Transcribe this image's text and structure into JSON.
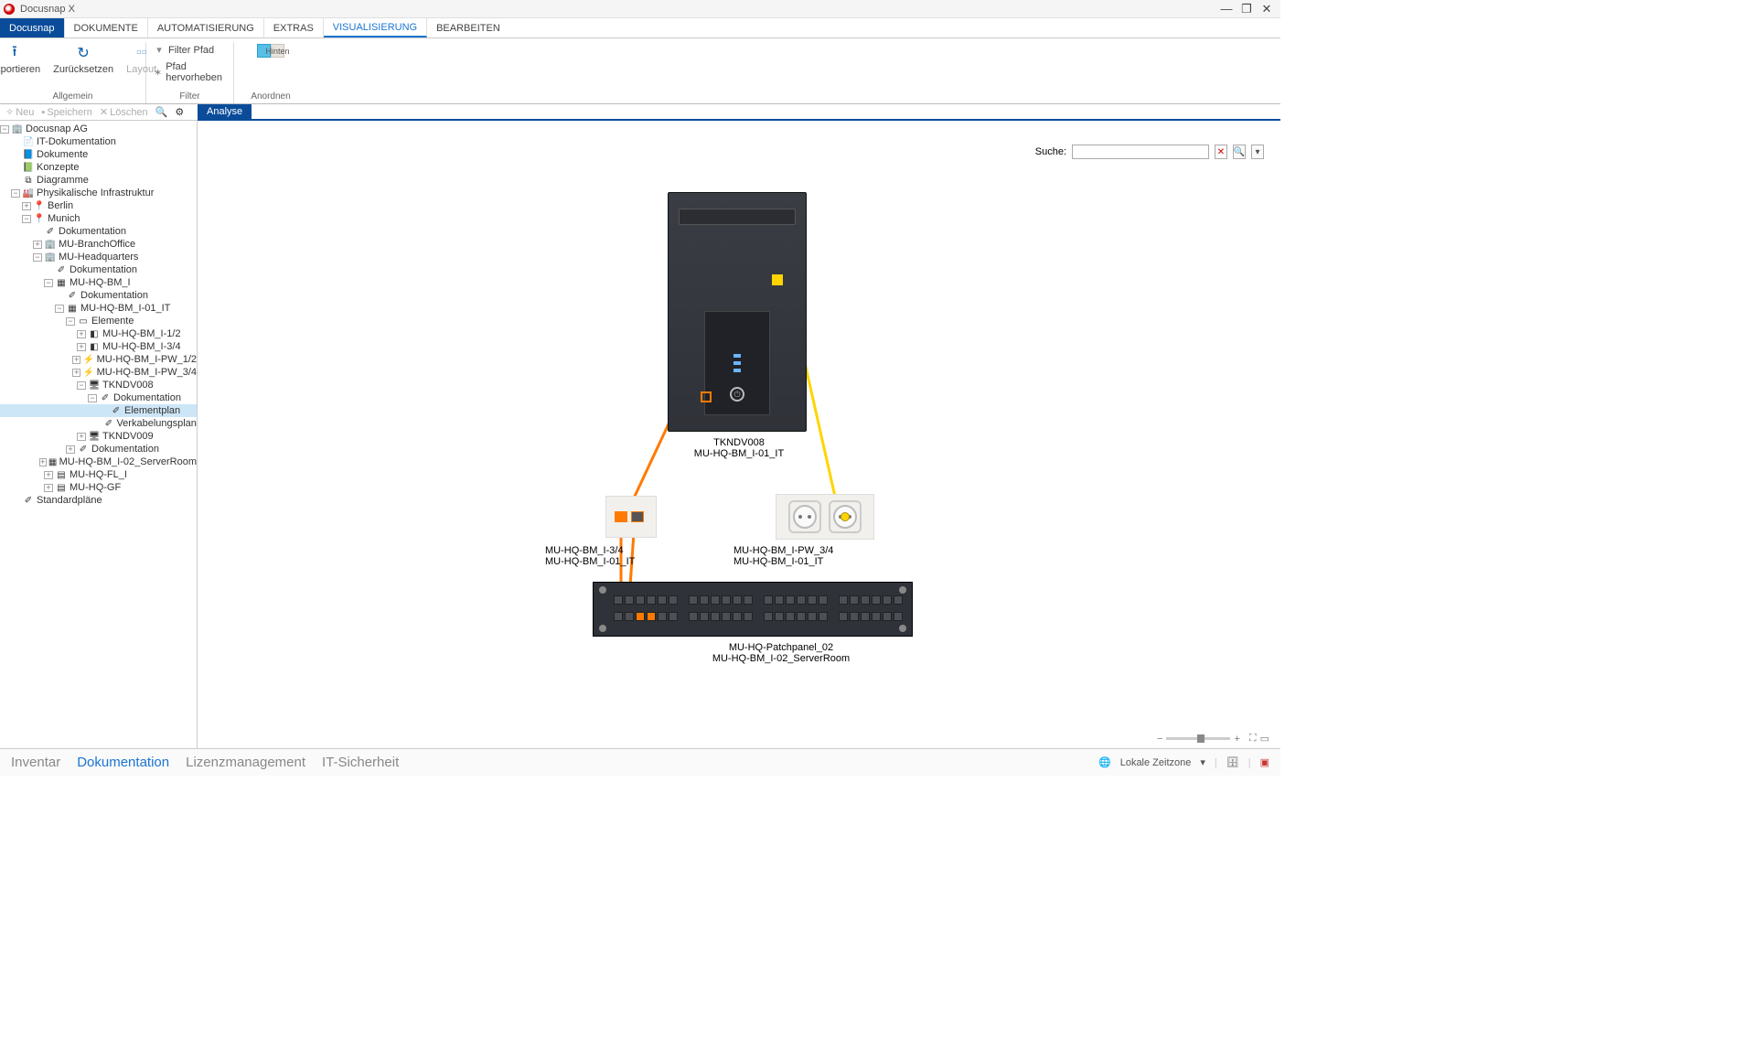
{
  "app": {
    "title": "Docusnap X"
  },
  "window_buttons": {
    "min": "—",
    "max": "❐",
    "close": "✕"
  },
  "menu": {
    "file": "Docusnap",
    "items": [
      "DOKUMENTE",
      "AUTOMATISIERUNG",
      "EXTRAS",
      "VISUALISIERUNG",
      "BEARBEITEN"
    ],
    "active_index": 3
  },
  "ribbon": {
    "export": "Exportieren",
    "reset": "Zurücksetzen",
    "layout": "Layout",
    "group_allgemein": "Allgemein",
    "filter_pfad": "Filter Pfad",
    "pfad_hervor": "Pfad hervorheben",
    "group_filter": "Filter",
    "hinten": "Hinten",
    "group_anordnen": "Anordnen"
  },
  "toolbar2": {
    "neu": "Neu",
    "speichern": "Speichern",
    "loeschen": "Löschen"
  },
  "analyse_tab": "Analyse",
  "search": {
    "label": "Suche:",
    "value": ""
  },
  "tree": {
    "n0": "Docusnap AG",
    "n1": "IT-Dokumentation",
    "n2": "Dokumente",
    "n3": "Konzepte",
    "n4": "Diagramme",
    "n5": "Physikalische Infrastruktur",
    "n6": "Berlin",
    "n7": "Munich",
    "n8": "Dokumentation",
    "n9": "MU-BranchOffice",
    "n10": "MU-Headquarters",
    "n11": "Dokumentation",
    "n12": "MU-HQ-BM_I",
    "n13": "Dokumentation",
    "n14": "MU-HQ-BM_I-01_IT",
    "n15": "Elemente",
    "n16": "MU-HQ-BM_I-1/2",
    "n17": "MU-HQ-BM_I-3/4",
    "n18": "MU-HQ-BM_I-PW_1/2",
    "n19": "MU-HQ-BM_I-PW_3/4",
    "n20": "TKNDV008",
    "n21": "Dokumentation",
    "n22": "Elementplan",
    "n23": "Verkabelungsplan",
    "n24": "TKNDV009",
    "n25": "Dokumentation",
    "n26": "MU-HQ-BM_I-02_ServerRoom",
    "n27": "MU-HQ-FL_I",
    "n28": "MU-HQ-GF",
    "n29": "Standardpläne"
  },
  "diagram": {
    "tower_name": "TKNDV008",
    "tower_loc": "MU-HQ-BM_I-01_IT",
    "jack_name": "MU-HQ-BM_I-3/4",
    "jack_loc": "MU-HQ-BM_I-01_IT",
    "power_name": "MU-HQ-BM_I-PW_3/4",
    "power_loc": "MU-HQ-BM_I-01_IT",
    "patch_name": "MU-HQ-Patchpanel_02",
    "patch_loc": "MU-HQ-BM_I-02_ServerRoom"
  },
  "bottom_nav": {
    "inventar": "Inventar",
    "dokumentation": "Dokumentation",
    "lizenz": "Lizenzmanagement",
    "itsich": "IT-Sicherheit"
  },
  "status": {
    "tz": "Lokale Zeitzone"
  }
}
